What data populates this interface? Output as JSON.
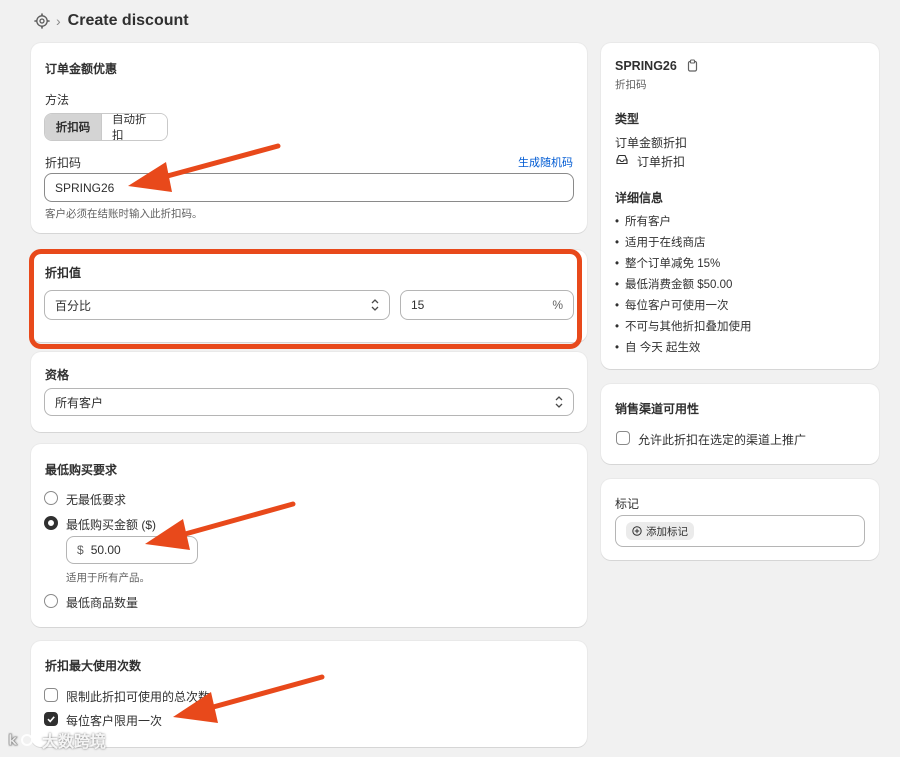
{
  "header": {
    "title": "Create discount",
    "icon": "gear-icon"
  },
  "main_card": {
    "title": "订单金额优惠",
    "method_label": "方法",
    "method_options": [
      "折扣码",
      "自动折扣"
    ],
    "code_label": "折扣码",
    "generate_link": "生成随机码",
    "code_value": "SPRING26",
    "code_help": "客户必须在结账时输入此折扣码。"
  },
  "value_card": {
    "title": "折扣值",
    "type_value": "百分比",
    "amount_value": "15",
    "amount_suffix": "%"
  },
  "eligibility_card": {
    "title": "资格",
    "value": "所有客户"
  },
  "min_req_card": {
    "title": "最低购买要求",
    "options": [
      "无最低要求",
      "最低购买金额 ($)",
      "最低商品数量"
    ],
    "selected": 1,
    "currency": "$",
    "amount": "50.00",
    "help": "适用于所有产品。"
  },
  "max_uses_card": {
    "title": "折扣最大使用次数",
    "options": [
      {
        "label": "限制此折扣可使用的总次数",
        "checked": false
      },
      {
        "label": "每位客户限用一次",
        "checked": true
      }
    ]
  },
  "summary": {
    "code": "SPRING26",
    "code_sub": "折扣码",
    "type_title": "类型",
    "type_value": "订单金额折扣",
    "type_tag": "订单折扣",
    "details_title": "详细信息",
    "details": [
      "所有客户",
      "适用于在线商店",
      "整个订单减免 15%",
      "最低消费金额 $50.00",
      "每位客户可使用一次",
      "不可与其他折扣叠加使用",
      "自 今天 起生效"
    ]
  },
  "channels": {
    "title": "销售渠道可用性",
    "option": "允许此折扣在选定的渠道上推广"
  },
  "tags": {
    "title": "标记",
    "add_label": "添加标记"
  },
  "annotations": {
    "arrow_color": "#e8491b",
    "highlight_color": "#e8491b"
  },
  "watermark": "大数跨境"
}
